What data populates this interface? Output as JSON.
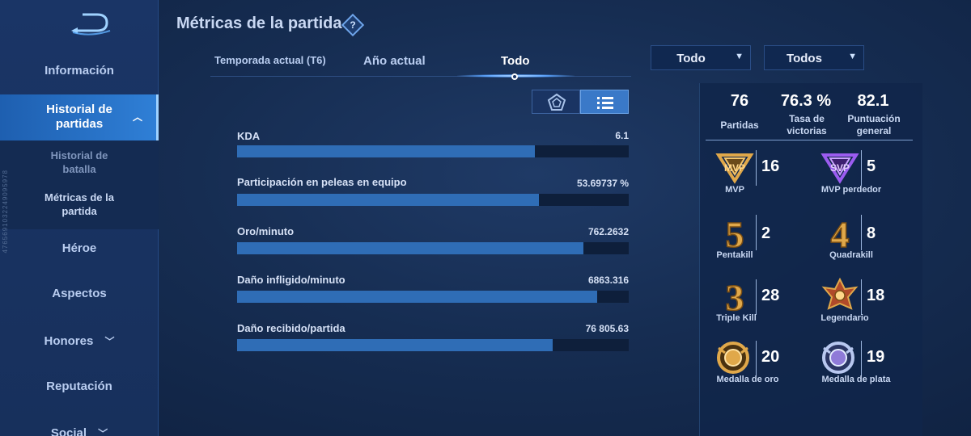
{
  "header": {
    "title": "Métricas de la partida"
  },
  "side_id": "4765691032249095978",
  "sidebar": {
    "items": [
      {
        "label": "Información"
      },
      {
        "label": "Historial de partidas"
      },
      {
        "label": "Héroe"
      },
      {
        "label": "Aspectos"
      },
      {
        "label": "Honores"
      },
      {
        "label": "Reputación"
      },
      {
        "label": "Social"
      }
    ],
    "subitems": [
      {
        "label": "Historial de batalla"
      },
      {
        "label": "Métricas de la partida"
      }
    ]
  },
  "tabs": [
    {
      "label": "Temporada actual (T6)"
    },
    {
      "label": "Año actual"
    },
    {
      "label": "Todo"
    }
  ],
  "filters": [
    {
      "value": "Todo"
    },
    {
      "value": "Todos"
    }
  ],
  "metrics": [
    {
      "label": "KDA",
      "value": "6.1",
      "fill": 0.76
    },
    {
      "label": "Participación en peleas en equipo",
      "value": "53.69737 %",
      "fill": 0.77
    },
    {
      "label": "Oro/minuto",
      "value": "762.2632",
      "fill": 0.885
    },
    {
      "label": "Daño infligido/minuto",
      "value": "6863.316",
      "fill": 0.92
    },
    {
      "label": "Daño recibido/partida",
      "value": "76 805.63",
      "fill": 0.805
    }
  ],
  "summary": {
    "matches": {
      "value": "76",
      "label": "Partidas"
    },
    "winrate": {
      "value": "76.3 %",
      "label": "Tasa de victorias"
    },
    "score": {
      "value": "82.1",
      "label": "Puntuación general"
    }
  },
  "achievements": [
    {
      "name": "MVP",
      "count": "16",
      "icon": "mvp-icon"
    },
    {
      "name": "MVP perdedor",
      "count": "5",
      "icon": "svp-icon"
    },
    {
      "name": "Pentakill",
      "count": "2",
      "icon": "pentakill-icon"
    },
    {
      "name": "Quadrakill",
      "count": "8",
      "icon": "quadrakill-icon"
    },
    {
      "name": "Triple Kill",
      "count": "28",
      "icon": "triple-kill-icon"
    },
    {
      "name": "Legendario",
      "count": "18",
      "icon": "legendary-icon"
    },
    {
      "name": "Medalla de oro",
      "count": "20",
      "icon": "gold-medal-icon"
    },
    {
      "name": "Medalla de plata",
      "count": "19",
      "icon": "silver-medal-icon"
    }
  ],
  "badge_digits": {
    "penta": "5",
    "quadra": "4",
    "triple": "3"
  },
  "colors": {
    "accent": "#2f6db6",
    "active_tab": "#3a79c8",
    "gold": "#e0a84a",
    "purple": "#9b5cf0"
  }
}
